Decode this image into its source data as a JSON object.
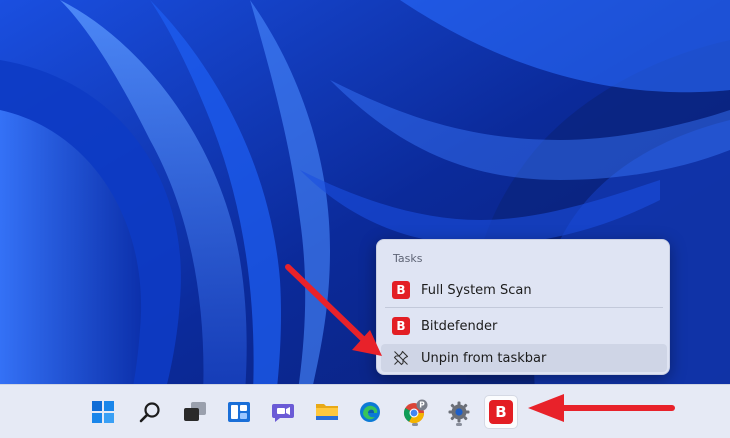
{
  "jumplist": {
    "header": "Tasks",
    "items": [
      {
        "label": "Full System Scan",
        "icon": "bitdefender-logo",
        "logo_letter": "B"
      },
      {
        "label": "Bitdefender",
        "icon": "bitdefender-logo",
        "logo_letter": "B"
      },
      {
        "label": "Unpin from taskbar",
        "icon": "unpin-icon"
      }
    ]
  },
  "taskbar": {
    "icons": [
      "start-icon",
      "search-icon",
      "task-view-icon",
      "widgets-icon",
      "chat-icon",
      "file-explorer-icon",
      "edge-icon",
      "chrome-icon",
      "settings-icon",
      "bitdefender-icon"
    ],
    "chrome_profile_letter": "P",
    "bitdefender_letter": "B"
  },
  "colors": {
    "accent_red": "#e31e24",
    "arrow_red": "#e8222a",
    "wallpaper_blue": "#0b2a9a",
    "menu_bg": "#dfe4f3",
    "taskbar_bg": "#e6eaf5"
  }
}
